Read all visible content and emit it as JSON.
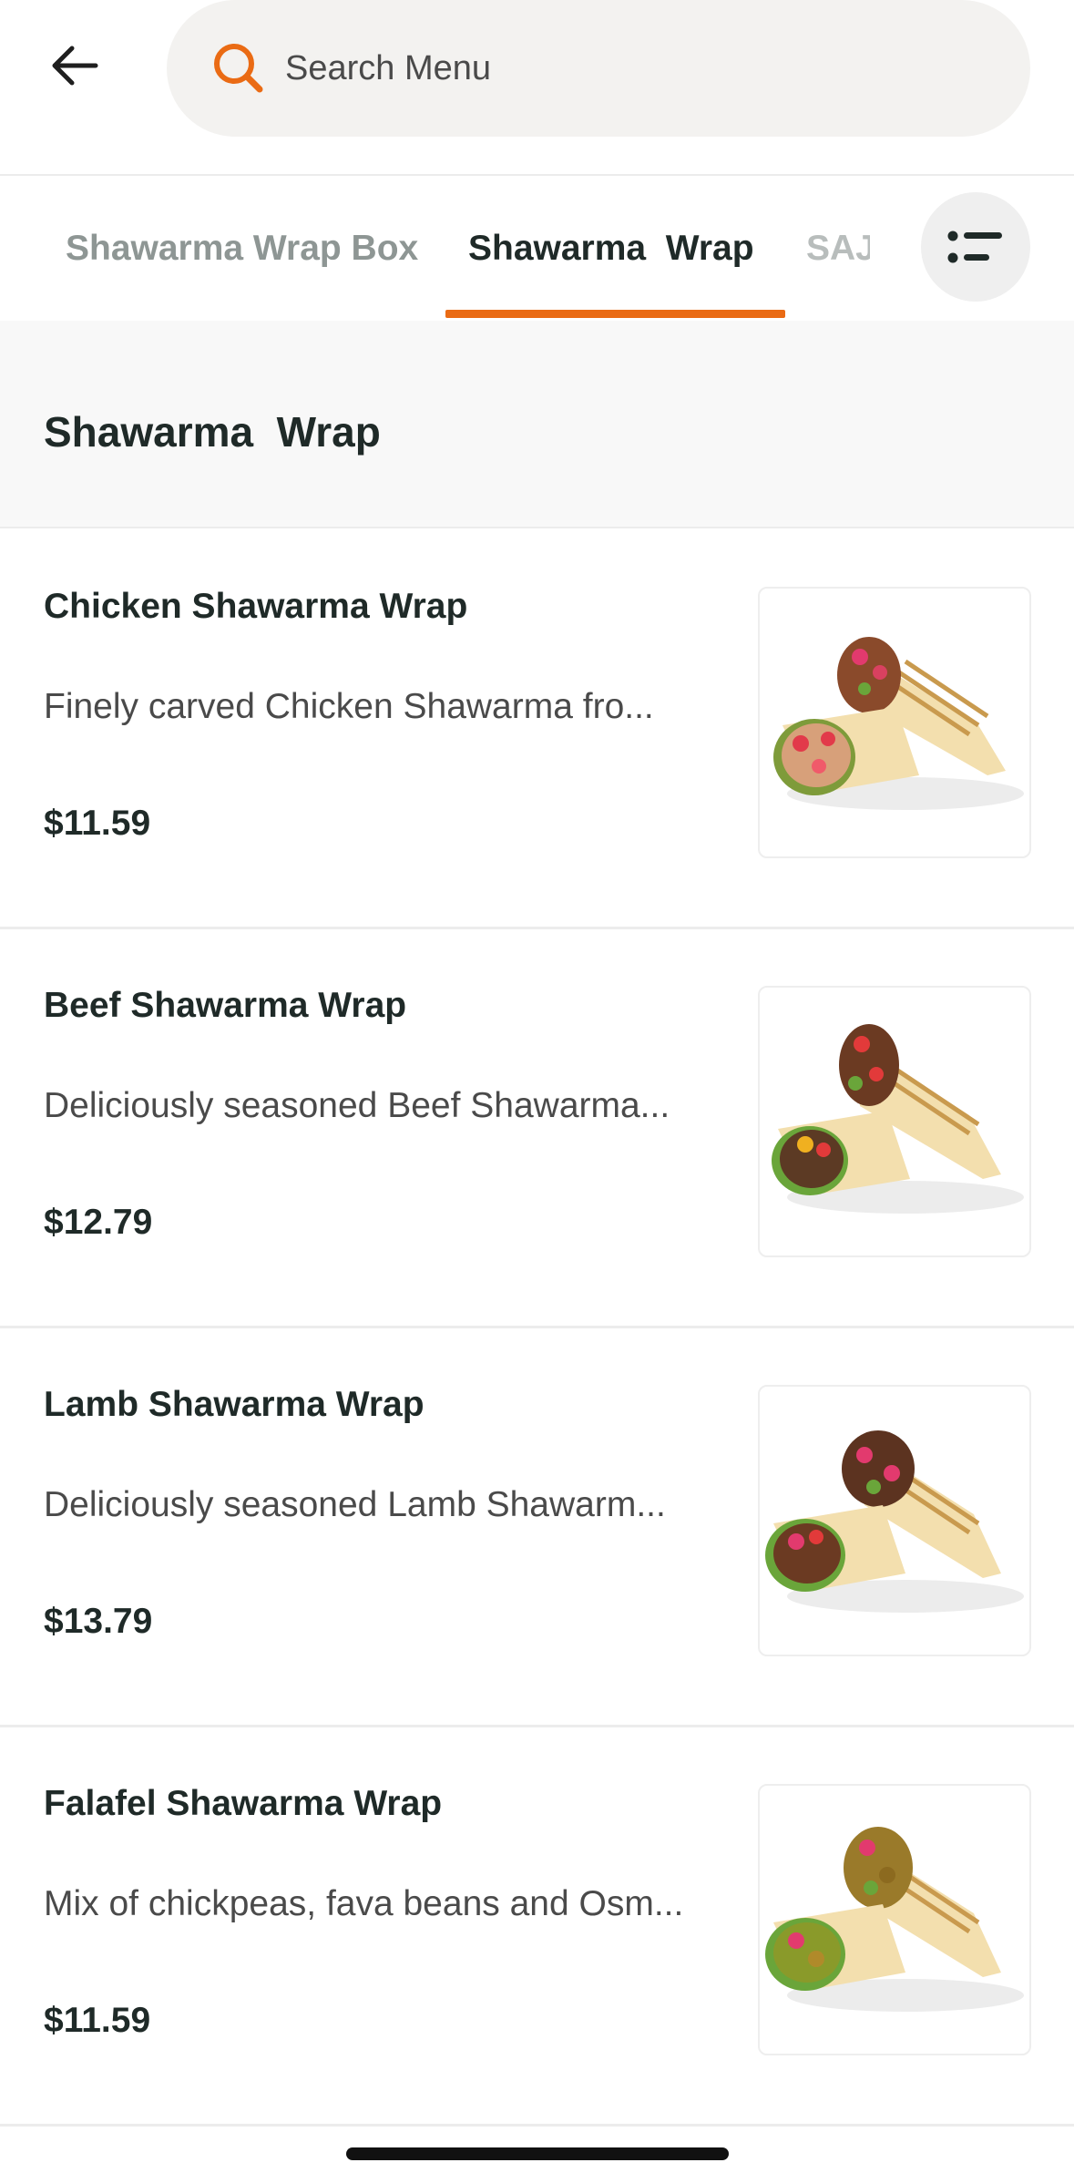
{
  "header": {
    "search_placeholder": "Search Menu"
  },
  "tabs": [
    {
      "label": "Shawarma Wrap Box",
      "active": false
    },
    {
      "label": "Shawarma  Wrap",
      "active": true
    },
    {
      "label": "SAJ",
      "active": false
    }
  ],
  "section": {
    "title": "Shawarma  Wrap"
  },
  "items": [
    {
      "name": "Chicken Shawarma Wrap",
      "description": "Finely carved Chicken Shawarma fro...",
      "price": "$11.59",
      "image": "chicken-shawarma-wrap-image"
    },
    {
      "name": "Beef Shawarma Wrap",
      "description": "Deliciously seasoned Beef Shawarma...",
      "price": "$12.79",
      "image": "beef-shawarma-wrap-image"
    },
    {
      "name": "Lamb Shawarma Wrap",
      "description": "Deliciously seasoned Lamb Shawarm...",
      "price": "$13.79",
      "image": "lamb-shawarma-wrap-image"
    },
    {
      "name": "Falafel Shawarma Wrap",
      "description": "Mix of chickpeas, fava beans and Osm...",
      "price": "$11.59",
      "image": "falafel-shawarma-wrap-image"
    }
  ],
  "colors": {
    "accent": "#ea6b14",
    "search_bg": "#f3f2f0",
    "section_bg": "#f8f8f8"
  },
  "icons": {
    "back": "arrow-left-icon",
    "search": "search-icon",
    "list": "list-icon"
  }
}
